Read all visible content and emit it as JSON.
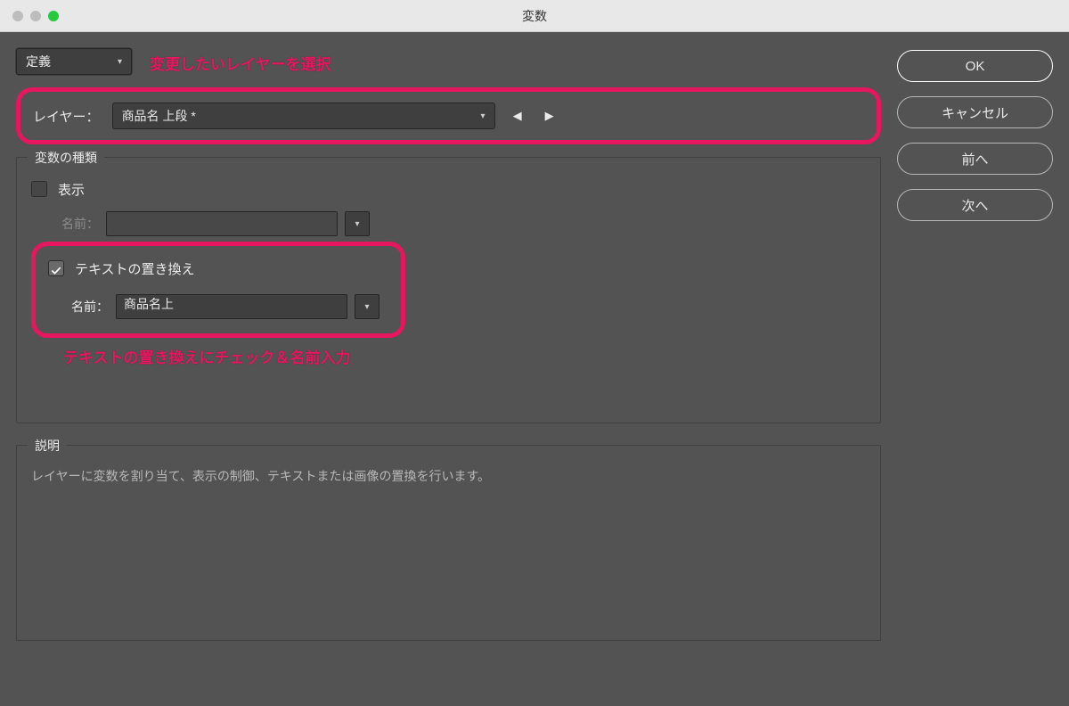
{
  "window": {
    "title": "変数"
  },
  "top": {
    "definition_label": "定義",
    "annotation1": "変更したいレイヤーを選択"
  },
  "layer": {
    "label": "レイヤー：",
    "selected": "商品名 上段 *"
  },
  "variable_type": {
    "legend": "変数の種類",
    "visibility": {
      "label": "表示",
      "checked": false,
      "name_label": "名前：",
      "name_value": ""
    },
    "text_replace": {
      "label": "テキストの置き換え",
      "checked": true,
      "name_label": "名前：",
      "name_value": "商品名上"
    },
    "annotation2": "テキストの置き換えにチェック＆名前入力"
  },
  "description": {
    "legend": "説明",
    "text": "レイヤーに変数を割り当て、表示の制御、テキストまたは画像の置換を行います。"
  },
  "buttons": {
    "ok": "OK",
    "cancel": "キャンセル",
    "prev": "前へ",
    "next": "次へ"
  }
}
